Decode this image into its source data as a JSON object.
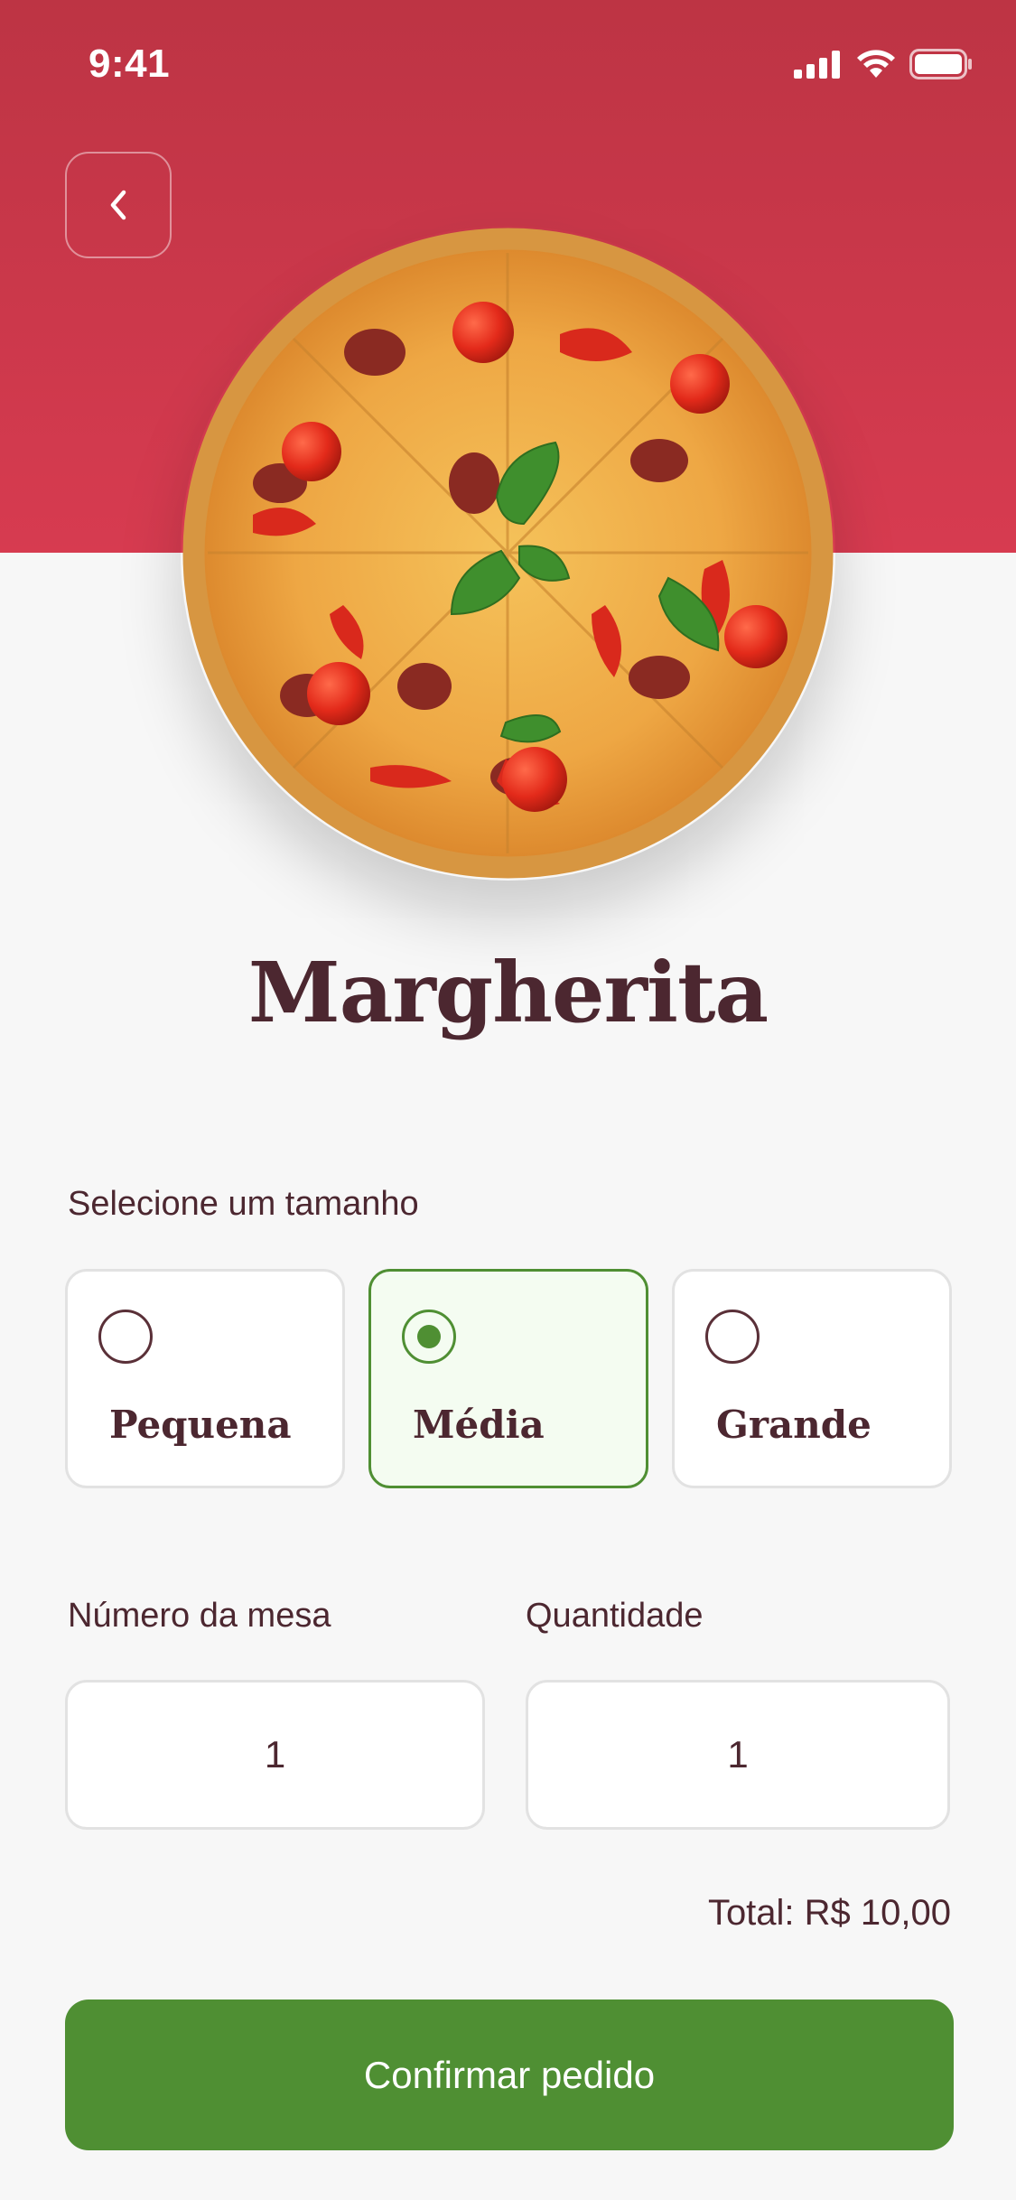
{
  "status_bar": {
    "time": "9:41",
    "icons": [
      "signal-icon",
      "wifi-icon",
      "battery-icon"
    ]
  },
  "header": {
    "back_icon": "chevron-left-icon"
  },
  "product": {
    "name": "Margherita",
    "image": "pizza-image"
  },
  "size_section": {
    "label": "Selecione um tamanho",
    "options": [
      {
        "label": "Pequena",
        "selected": false
      },
      {
        "label": "Média",
        "selected": true
      },
      {
        "label": "Grande",
        "selected": false
      }
    ]
  },
  "table_field": {
    "label": "Número da mesa",
    "value": "1"
  },
  "quantity_field": {
    "label": "Quantidade",
    "value": "1"
  },
  "total": {
    "text": "Total: R$ 10,00"
  },
  "confirm_button": {
    "label": "Confirmar pedido"
  },
  "colors": {
    "hero_red": "#c93a4a",
    "accent_green": "#4f8f33",
    "text_brown": "#4c2730",
    "background": "#f7f7f7"
  }
}
